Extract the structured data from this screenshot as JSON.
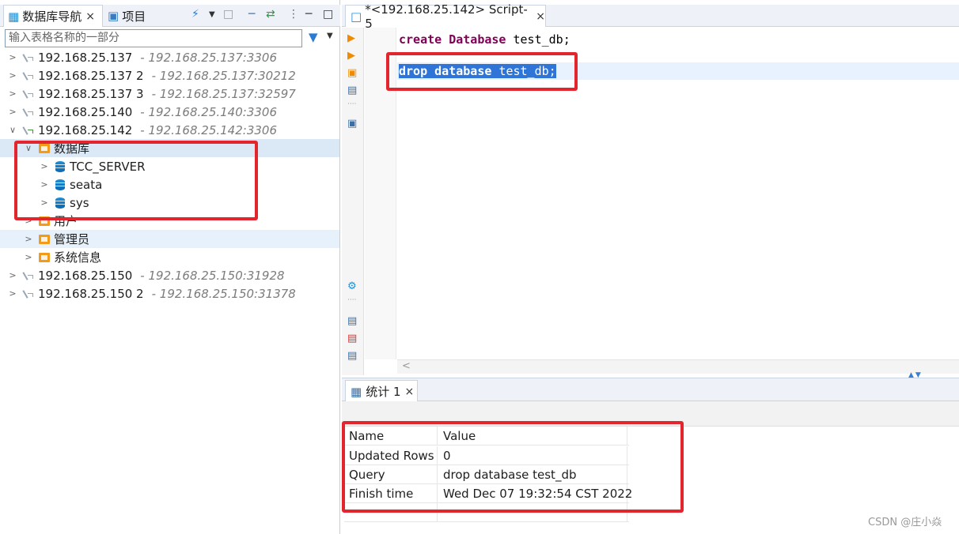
{
  "left": {
    "tabs": [
      {
        "label": "数据库导航",
        "close": "×"
      },
      {
        "label": "项目"
      }
    ],
    "filter_placeholder": "输入表格名称的一部分",
    "tree": [
      {
        "name": "192.168.25.137",
        "addr": "- 192.168.25.137:3306"
      },
      {
        "name": "192.168.25.137 2",
        "addr": "- 192.168.25.137:30212"
      },
      {
        "name": "192.168.25.137 3",
        "addr": "- 192.168.25.137:32597"
      },
      {
        "name": "192.168.25.140",
        "addr": "- 192.168.25.140:3306"
      },
      {
        "name": "192.168.25.142",
        "addr": "- 192.168.25.142:3306"
      },
      {
        "name": "数据库"
      },
      {
        "name": "TCC_SERVER"
      },
      {
        "name": "seata"
      },
      {
        "name": "sys"
      },
      {
        "name": "用户"
      },
      {
        "name": "管理员"
      },
      {
        "name": "系统信息"
      },
      {
        "name": "192.168.25.150",
        "addr": "- 192.168.25.150:31928"
      },
      {
        "name": "192.168.25.150 2",
        "addr": "- 192.168.25.150:31378"
      }
    ]
  },
  "editor": {
    "tab_label": "*<192.168.25.142> Script-5",
    "tab_close": "×",
    "line1": {
      "kw1": "create",
      "kw2": "Database",
      "rest": "test_db;"
    },
    "line2": {
      "kw1": "drop",
      "kw2": "database",
      "rest": "test_db;"
    }
  },
  "results": {
    "tab_label": "统计 1",
    "tab_close": "×",
    "rows": [
      {
        "name": "Name",
        "value": "Value"
      },
      {
        "name": "Updated Rows",
        "value": "0"
      },
      {
        "name": "Query",
        "value": "drop database test_db"
      },
      {
        "name": "Finish time",
        "value": "Wed Dec 07 19:32:54 CST 2022"
      }
    ]
  },
  "watermark": "CSDN @庄小焱",
  "colors": {
    "highlight": "#e3262e",
    "keyword": "#7f0055",
    "selection": "#2f75d8"
  },
  "icons": [
    "database-nav-icon",
    "project-icon",
    "plug-icon",
    "filter-icon",
    "server-icon",
    "database-cylinder-icon",
    "folder-icon",
    "script-icon",
    "grid-icon",
    "run-icon",
    "gear-icon"
  ]
}
